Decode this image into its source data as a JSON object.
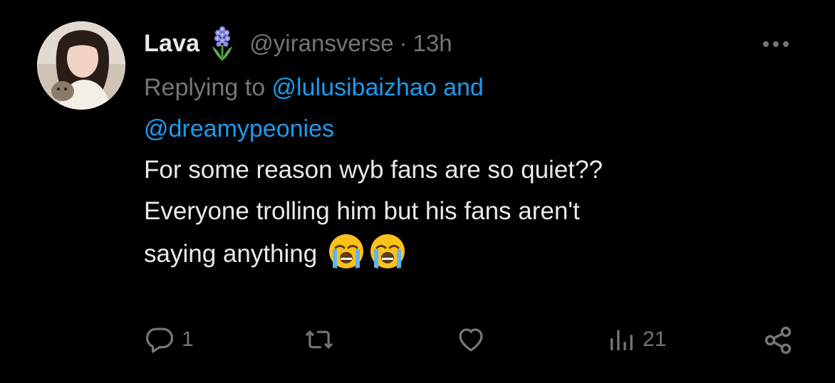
{
  "author": {
    "name": "Lava",
    "name_emoji_icon": "hyacinth-flower-icon",
    "handle": "@yiransverse",
    "separator": "·",
    "time": "13h"
  },
  "reply": {
    "prefix": "Replying to ",
    "mention_1": "@lulusibaizhao",
    "connector": " and",
    "mention_2": "@dreamypeonies"
  },
  "content": {
    "line_1": "For some reason wyb fans are so quiet??",
    "line_2": "Everyone trolling him but his fans aren't",
    "line_3": "saying anything",
    "emoji": [
      "loudly-crying-face-icon",
      "loudly-crying-face-icon"
    ]
  },
  "actions": {
    "reply_count": "1",
    "retweet_count": "",
    "like_count": "",
    "views_count": "21"
  },
  "colors": {
    "background": "#000000",
    "text": "#e7e9ea",
    "muted": "#71767b",
    "link": "#1d9bf0"
  }
}
